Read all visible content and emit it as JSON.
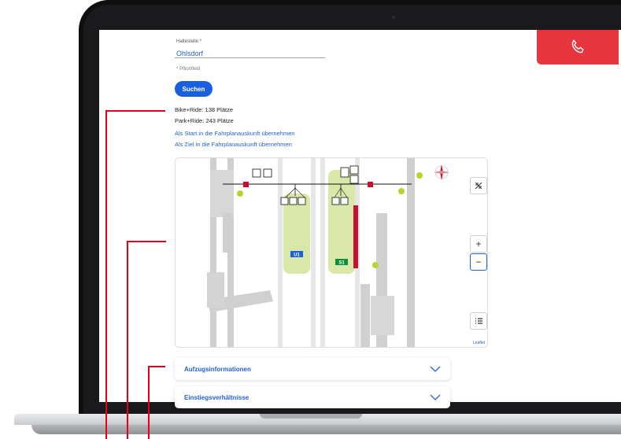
{
  "form": {
    "stop_label": "Haltestelle *",
    "stop_value": "Ohlsdorf",
    "required_note": "* Pflichtfeld",
    "search_button": "Suchen"
  },
  "info": {
    "bike_ride": "Bike+Ride: 138 Plätze",
    "park_ride": "Park+Ride: 243 Plätze"
  },
  "links": {
    "as_start": "Als Start in die Fahrplanauskunft übernehmen",
    "as_destination": "Als Ziel in die Fahrplanauskunft übernehmen"
  },
  "map": {
    "attribution": "Leaflet",
    "zoom_in": "+",
    "zoom_out": "−",
    "platform_labels": [
      "U1",
      "S1"
    ],
    "lift_icon": "lift-icon",
    "stair_icon": "stairs-icon",
    "compass_icon": "compass-rose-icon",
    "layers_icon": "legend-list-icon",
    "fullscreen_icon": "collapse-icon"
  },
  "accordions": [
    {
      "label": "Aufzugsinformationen"
    },
    {
      "label": "Einstiegsverhältnisse"
    }
  ],
  "colors": {
    "accent_blue": "#1a5fe0",
    "link_blue": "#2462d4",
    "brand_red": "#e2001a",
    "phone_red": "#e8343c",
    "platform_green": "#d9e8a8"
  },
  "header": {
    "phone_icon": "phone-icon"
  }
}
